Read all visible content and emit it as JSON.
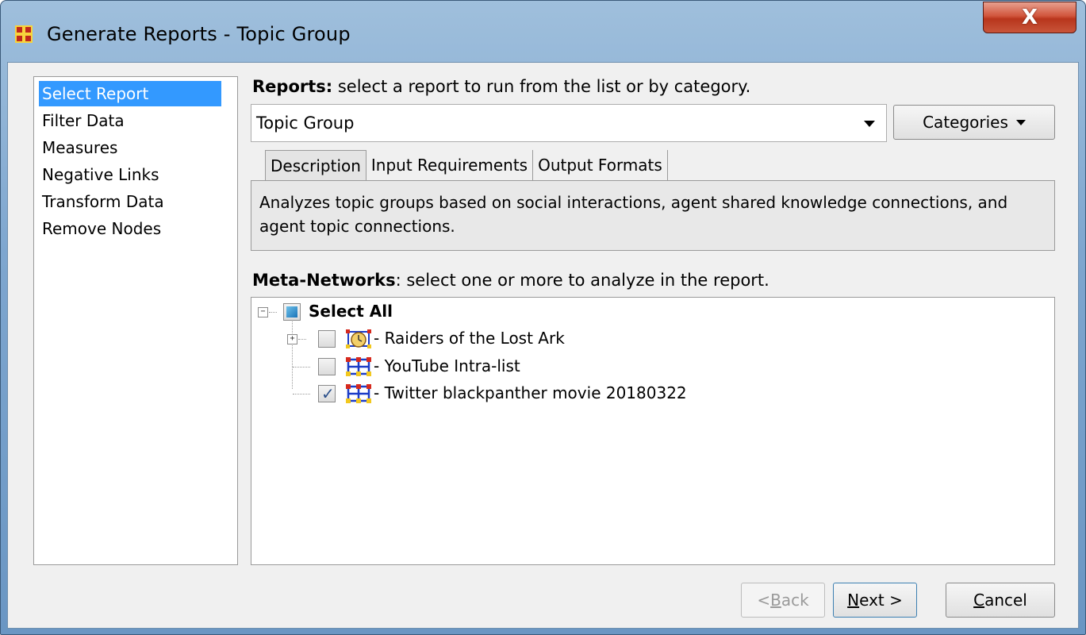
{
  "window": {
    "title": "Generate Reports - Topic Group",
    "close_label": "X"
  },
  "sidebar": {
    "items": [
      {
        "label": "Select Report",
        "selected": true
      },
      {
        "label": "Filter Data",
        "selected": false
      },
      {
        "label": "Measures",
        "selected": false
      },
      {
        "label": "Negative Links",
        "selected": false
      },
      {
        "label": "Transform Data",
        "selected": false
      },
      {
        "label": "Remove Nodes",
        "selected": false
      }
    ]
  },
  "reports": {
    "label_bold": "Reports:",
    "label_rest": " select a report to run from the list or by category.",
    "selected_value": "Topic Group",
    "categories_label": "Categories"
  },
  "tabs": [
    {
      "label": "Description",
      "active": true
    },
    {
      "label": "Input Requirements",
      "active": false
    },
    {
      "label": "Output Formats",
      "active": false
    }
  ],
  "description": "Analyzes topic groups based on social interactions, agent shared knowledge connections, and agent topic connections.",
  "meta_networks": {
    "label_bold": "Meta-Networks",
    "label_rest": ": select one or more to analyze in the report.",
    "select_all": "Select All",
    "items": [
      {
        "label": "- Raiders of the Lost Ark",
        "checked": false,
        "expandable": true,
        "icon": "dynamic-network-clock-icon"
      },
      {
        "label": "- YouTube Intra-list",
        "checked": false,
        "expandable": false,
        "icon": "network-graph-icon"
      },
      {
        "label": "- Twitter blackpanther movie 20180322",
        "checked": true,
        "expandable": false,
        "icon": "network-graph-icon"
      }
    ]
  },
  "buttons": {
    "back": {
      "prefix": "< ",
      "mnemonic": "B",
      "rest": "ack",
      "enabled": false
    },
    "next": {
      "mnemonic": "N",
      "rest": "ext >",
      "enabled": true
    },
    "cancel": {
      "mnemonic": "C",
      "rest": "ancel",
      "enabled": true
    }
  },
  "colors": {
    "selection": "#3399ff",
    "client_bg": "#f0f0f0",
    "close_red": "#c8553a"
  }
}
